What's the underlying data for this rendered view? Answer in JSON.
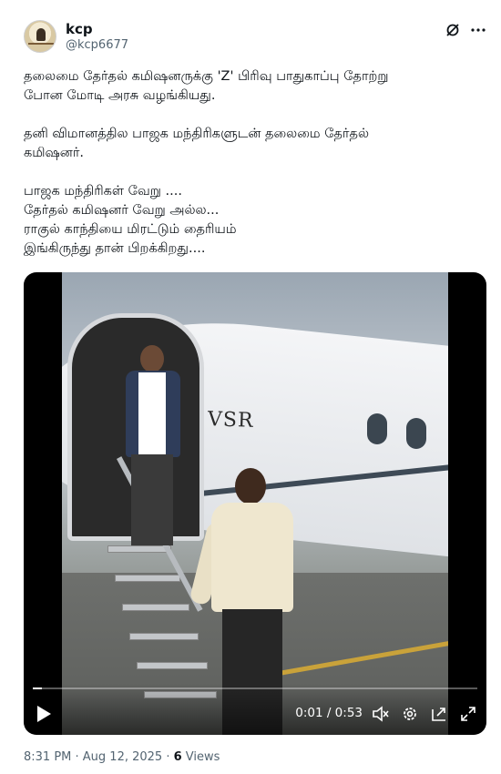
{
  "author": {
    "name": "kcp",
    "handle": "@kcp6677"
  },
  "tweet": {
    "text": "தலைமை தேர்தல் கமிஷனருக்கு 'Z' பிரிவு பாதுகாப்பு தோற்று\nபோன மோடி அரசு வழங்கியது.\n\nதனி விமானத்தில பாஜக மந்திரிகளுடன் தலைமை தேர்தல்\nகமிஷனர்.\n\nபாஜக மந்திரிகள் வேறு ....\nதேர்தல் கமிஷனர் வேறு அல்ல...\nராகுல் காந்தியை மிரட்டும் தைரியம்\nஇங்கிருந்து தான் பிறக்கிறது...."
  },
  "video": {
    "tail_marking": "VSR",
    "time_display": "0:01 / 0:53",
    "progress_fraction": 0.02,
    "icons": [
      "play-icon",
      "mute-icon",
      "settings-icon",
      "pip-icon",
      "fullscreen-icon"
    ]
  },
  "footer": {
    "timestamp": "8:31 PM · Aug 12, 2025 · ",
    "views_count": "6",
    "views_label": " Views"
  },
  "header_icons": [
    "grok-icon",
    "more-icon"
  ],
  "colors": {
    "text": "#0f1419",
    "secondary": "#536471"
  }
}
